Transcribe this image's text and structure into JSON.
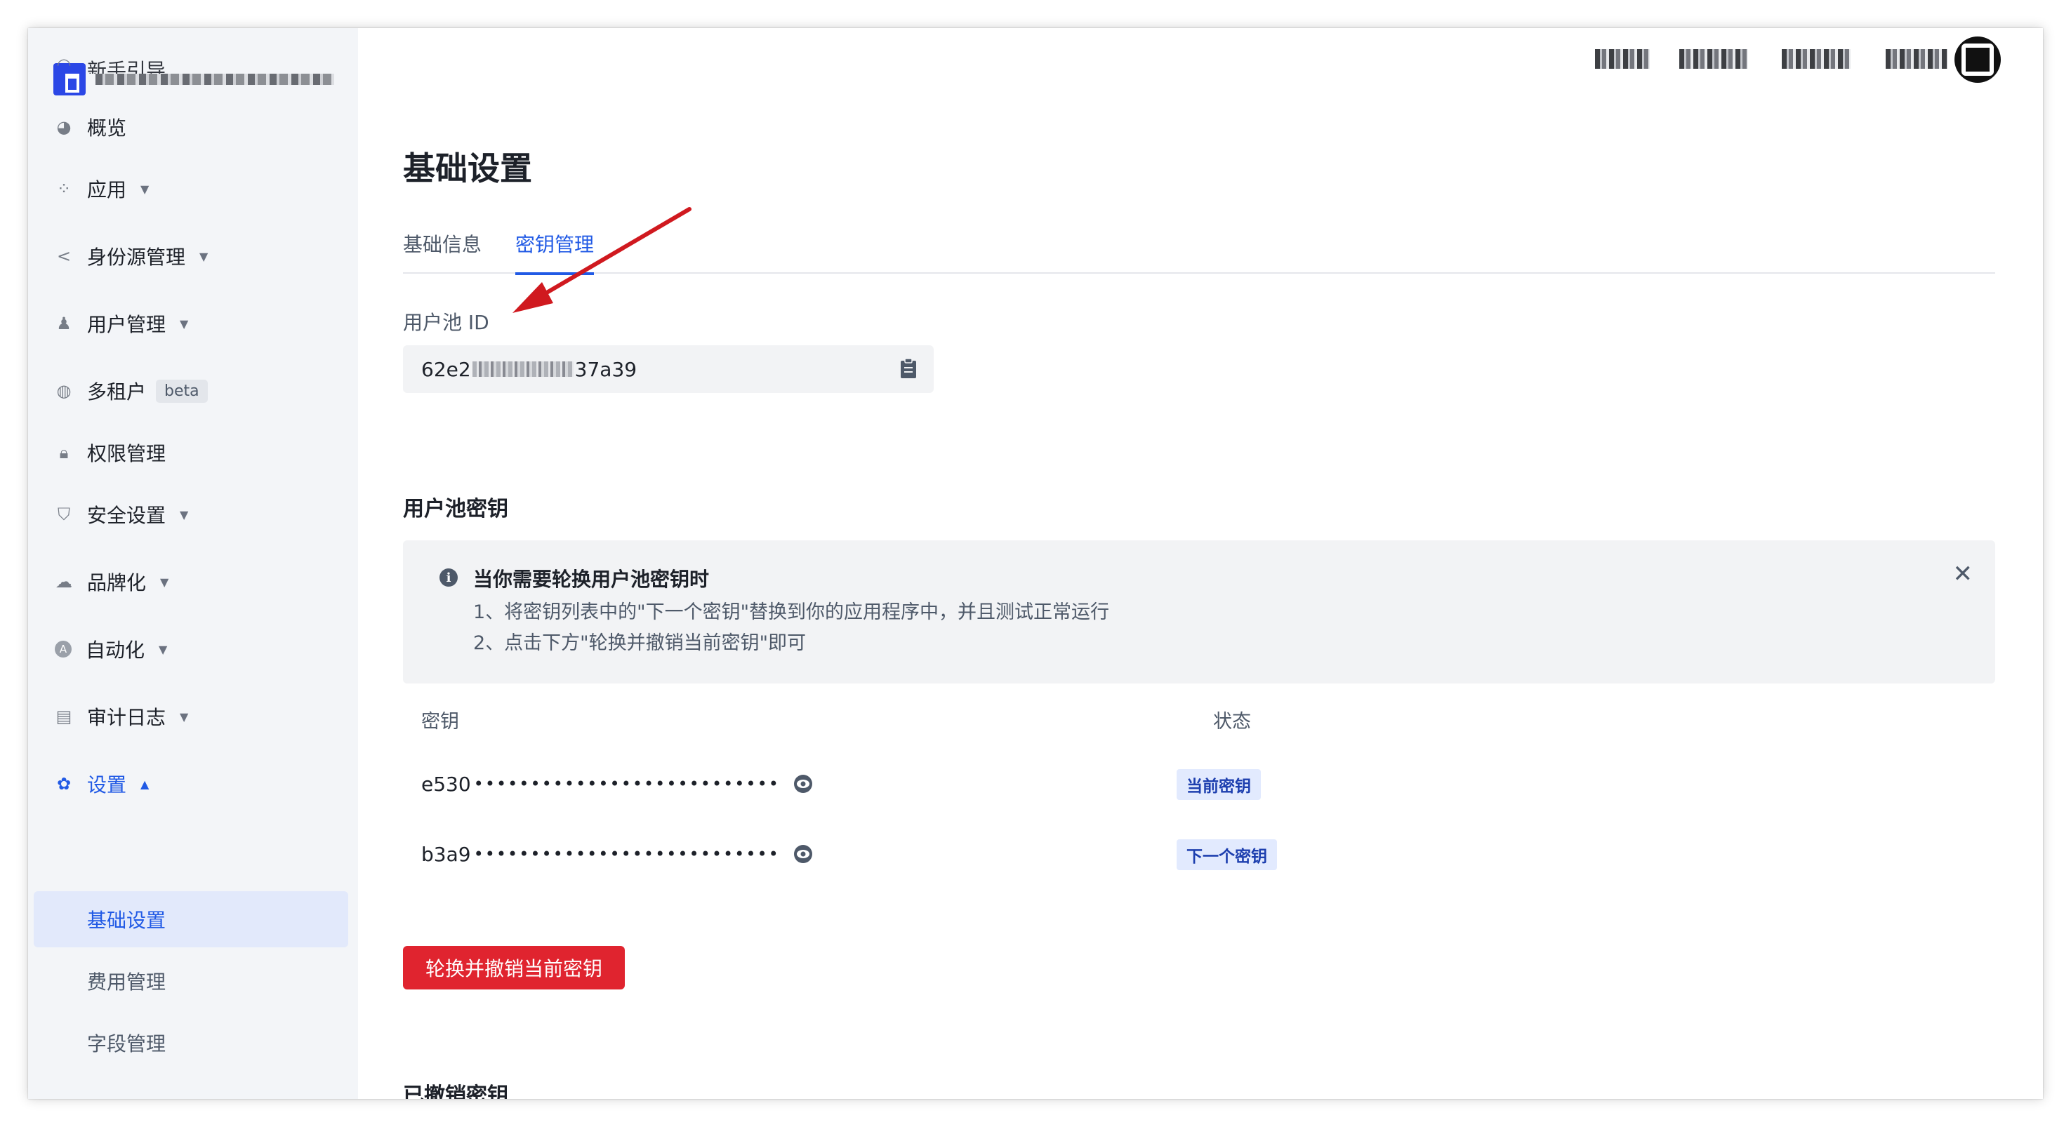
{
  "sidebar": {
    "partial_top_label": "新手引导",
    "items": [
      {
        "label": "概览",
        "icon": "pie-chart-icon"
      },
      {
        "label": "应用",
        "icon": "apps-grid-icon"
      },
      {
        "label": "身份源管理",
        "icon": "share-nodes-icon"
      },
      {
        "label": "用户管理",
        "icon": "users-icon"
      },
      {
        "label": "多租户",
        "icon": "tenant-icon",
        "badge": "beta"
      },
      {
        "label": "权限管理",
        "icon": "lock-icon"
      },
      {
        "label": "安全设置",
        "icon": "shield-icon"
      },
      {
        "label": "品牌化",
        "icon": "brush-icon"
      },
      {
        "label": "自动化",
        "icon": "automation-icon",
        "glyph": "A"
      },
      {
        "label": "审计日志",
        "icon": "log-icon"
      },
      {
        "label": "设置",
        "icon": "gear-icon"
      }
    ],
    "settings_sub": [
      "基础设置",
      "费用管理",
      "字段管理"
    ]
  },
  "main": {
    "title": "基础设置",
    "tabs": [
      "基础信息",
      "密钥管理"
    ],
    "active_tab": "密钥管理",
    "pool_id_label": "用户池 ID",
    "pool_id_prefix": "62e2",
    "pool_id_suffix": "37a39",
    "secret_section_title": "用户池密钥",
    "alert": {
      "title": "当你需要轮换用户池密钥时",
      "line1": "1、将密钥列表中的\"下一个密钥\"替换到你的应用程序中，并且测试正常运行",
      "line2": "2、点击下方\"轮换并撤销当前密钥\"即可",
      "close": "✕"
    },
    "table": {
      "col_key": "密钥",
      "col_status": "状态",
      "rows": [
        {
          "prefix": "e530",
          "mask": "•••••••••••••••••••••••••••",
          "status": "当前密钥"
        },
        {
          "prefix": "b3a9",
          "mask": "•••••••••••••••••••••••••••",
          "status": "下一个密钥"
        }
      ]
    },
    "rotate_button": "轮换并撤销当前密钥",
    "revoked_section_title": "已撤销密钥"
  },
  "colors": {
    "accent": "#215ae5",
    "danger": "#e0242f",
    "annotation_arrow": "#d0191f",
    "sidebar_bg": "#f3f5f8"
  }
}
